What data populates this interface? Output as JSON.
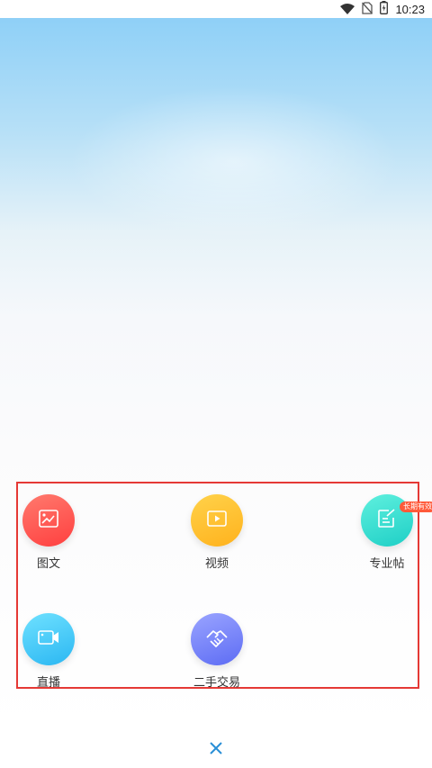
{
  "status_bar": {
    "time": "10:23",
    "icons": [
      "wifi-icon",
      "no-sim-icon",
      "battery-icon"
    ]
  },
  "publish_options": [
    {
      "label": "图文",
      "icon": "image-text-icon",
      "gradient": [
        "#ff7a6e",
        "#ff3f3f"
      ]
    },
    {
      "label": "视频",
      "icon": "video-play-icon",
      "gradient": [
        "#ffd24a",
        "#ffb21d"
      ]
    },
    {
      "label": "专业帖",
      "icon": "edit-note-icon",
      "gradient": [
        "#5ff0de",
        "#1ecfc6"
      ],
      "badge": "长期有效"
    },
    {
      "label": "直播",
      "icon": "live-camera-icon",
      "gradient": [
        "#6fe1ff",
        "#2bb7f2"
      ]
    },
    {
      "label": "二手交易",
      "icon": "handshake-icon",
      "gradient": [
        "#9aa4ff",
        "#5d6cf4"
      ]
    }
  ],
  "bottom": {
    "close_icon": "close-icon",
    "accent": "#2a8fd6"
  }
}
